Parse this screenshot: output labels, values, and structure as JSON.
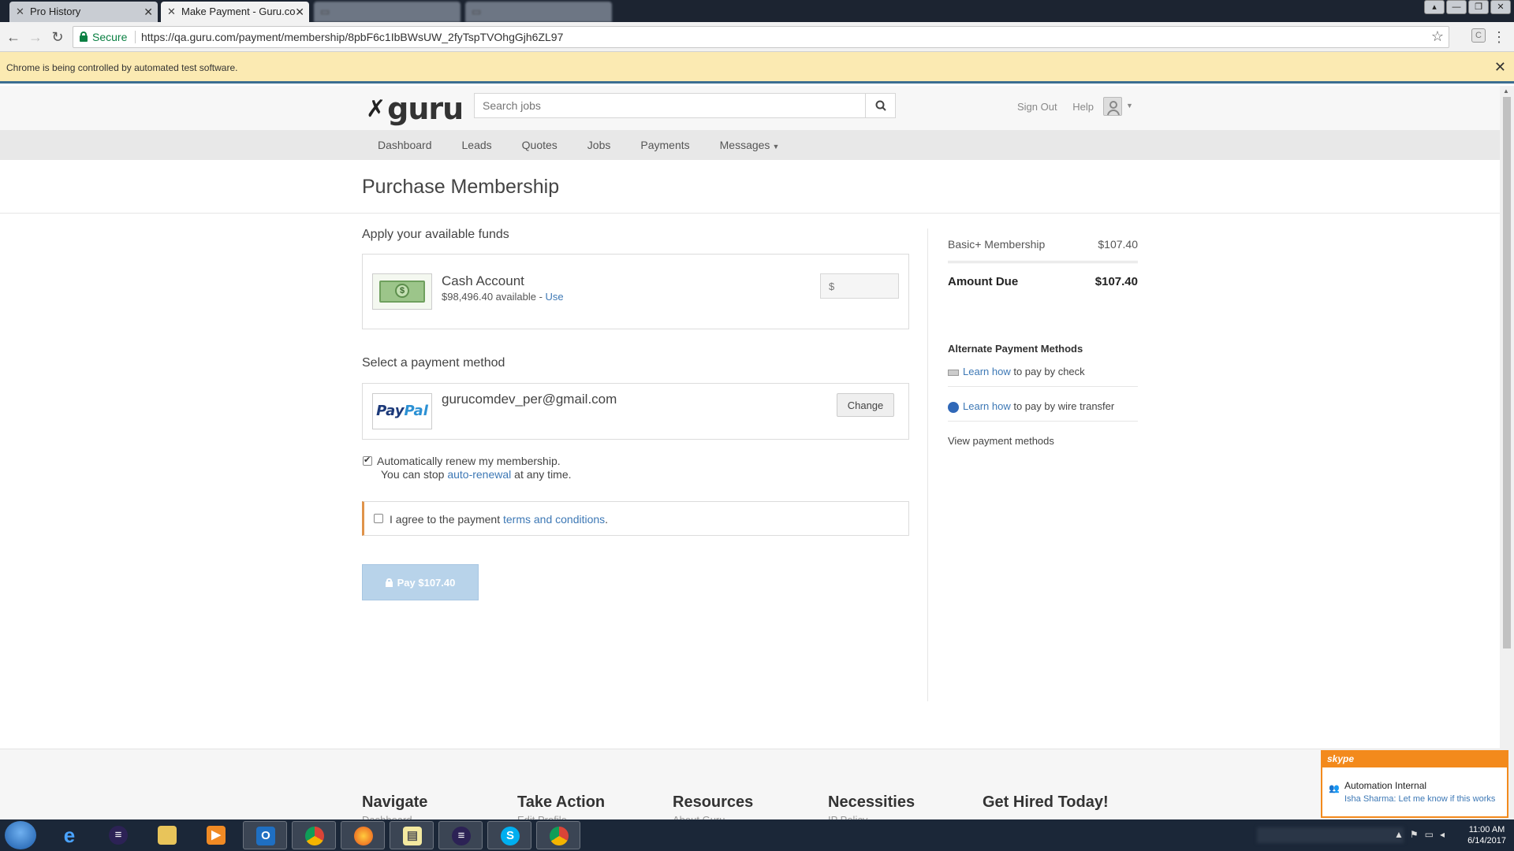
{
  "browser": {
    "tabs": [
      {
        "title": "Pro History",
        "active": false
      },
      {
        "title": "Make Payment - Guru.co",
        "active": true
      },
      {
        "title": "",
        "active": false
      },
      {
        "title": "",
        "active": false
      }
    ],
    "secure_label": "Secure",
    "url": "https://qa.guru.com/payment/membership/8pbF6c1IbBWsUW_2fyTspTVOhgGjh6ZL97",
    "infobar_text": "Chrome is being controlled by automated test software."
  },
  "site": {
    "logo_text": "guru",
    "search_placeholder": "Search jobs",
    "header_links": [
      "Sign Out",
      "Help"
    ],
    "nav": [
      "Dashboard",
      "Leads",
      "Quotes",
      "Jobs",
      "Payments",
      "Messages"
    ]
  },
  "page": {
    "title": "Purchase Membership",
    "funds_heading": "Apply your available funds",
    "cash_account": {
      "title": "Cash Account",
      "available": "$98,496.40 available - ",
      "use_link": "Use",
      "amount_placeholder": "$"
    },
    "payment_heading": "Select a payment method",
    "paypal": {
      "logo_a": "Pay",
      "logo_b": "Pal",
      "email": "gurucomdev_per@gmail.com",
      "change_label": "Change"
    },
    "auto_renew": {
      "checked": true,
      "line1": "Automatically renew my membership.",
      "line2_prefix": "You can stop ",
      "line2_link": "auto-renewal",
      "line2_suffix": " at any time."
    },
    "terms": {
      "checked": false,
      "prefix": "I agree to the payment ",
      "link": "terms and conditions",
      "suffix": "."
    },
    "pay_button": "Pay $107.40"
  },
  "sidebar": {
    "line_item": {
      "label": "Basic+ Membership",
      "value": "$107.40"
    },
    "total": {
      "label": "Amount Due",
      "value": "$107.40"
    },
    "alt_heading": "Alternate Payment Methods",
    "check_link": "Learn how",
    "check_text": " to pay by check",
    "wire_link": "Learn how",
    "wire_text": " to pay by wire transfer",
    "view_methods": "View payment methods"
  },
  "footer": {
    "columns": [
      "Navigate",
      "Take Action",
      "Resources",
      "Necessities",
      "Get Hired Today!"
    ],
    "subs": [
      "Dashboard",
      "Edit Profile",
      "About Guru",
      "IP Policy",
      ""
    ]
  },
  "skype": {
    "brand": "skype",
    "title": "Automation Internal",
    "message": "Isha Sharma: Let me know if this works"
  },
  "taskbar": {
    "time": "11:00 AM",
    "date": "6/14/2017"
  },
  "colors": {
    "link": "#3d78b5",
    "infobar": "#fbeab2",
    "pay_button_disabled": "#b8d3ea",
    "secure_green": "#0b8043",
    "skype_orange": "#f38a1c"
  }
}
